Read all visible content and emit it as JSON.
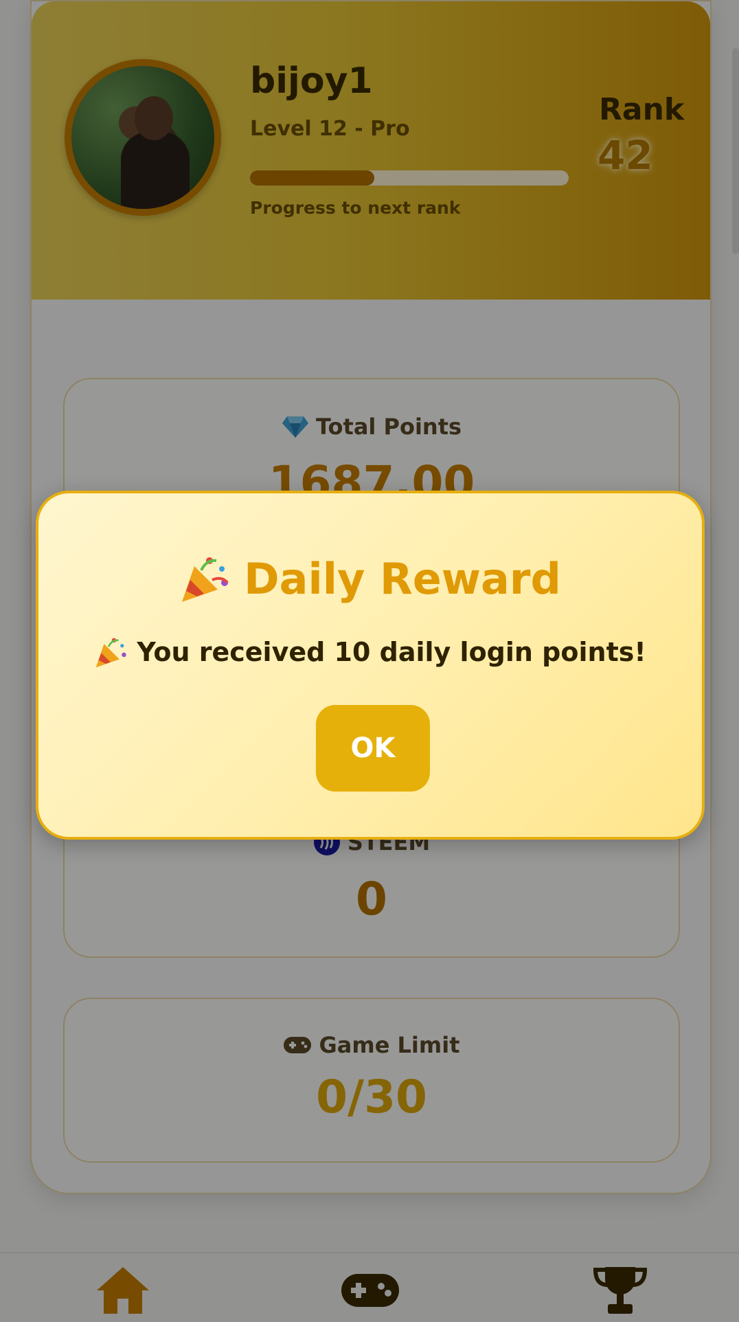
{
  "profile": {
    "username": "bijoy1",
    "level": "Level 12 - Pro",
    "progress_fraction": 0.39,
    "progress_label": "Progress to next rank",
    "rank_label": "Rank",
    "rank_value": "42"
  },
  "stats": {
    "total_points": {
      "icon": "diamond-icon",
      "label": "Total Points",
      "value": "1687.00"
    },
    "steem": {
      "icon": "steem-icon",
      "label": "STEEM",
      "value": "0"
    },
    "game_limit": {
      "icon": "gamepad-icon",
      "label": "Game Limit",
      "value": "0/30"
    }
  },
  "dialog": {
    "title_icon": "party-popper-icon",
    "title": "Daily Reward",
    "message_icon": "party-popper-icon",
    "message": "You received 10 daily login points!",
    "ok_label": "OK"
  },
  "nav": {
    "items": [
      {
        "icon": "home-icon"
      },
      {
        "icon": "gamepad-icon"
      },
      {
        "icon": "trophy-icon"
      }
    ]
  },
  "colors": {
    "accent": "#e6b00a",
    "header_gradient_start": "#ecd35a",
    "header_gradient_end": "#d3980d",
    "value_brown": "#b57200",
    "value_gold": "#e0a90a",
    "dialog_title": "#e09a06"
  }
}
